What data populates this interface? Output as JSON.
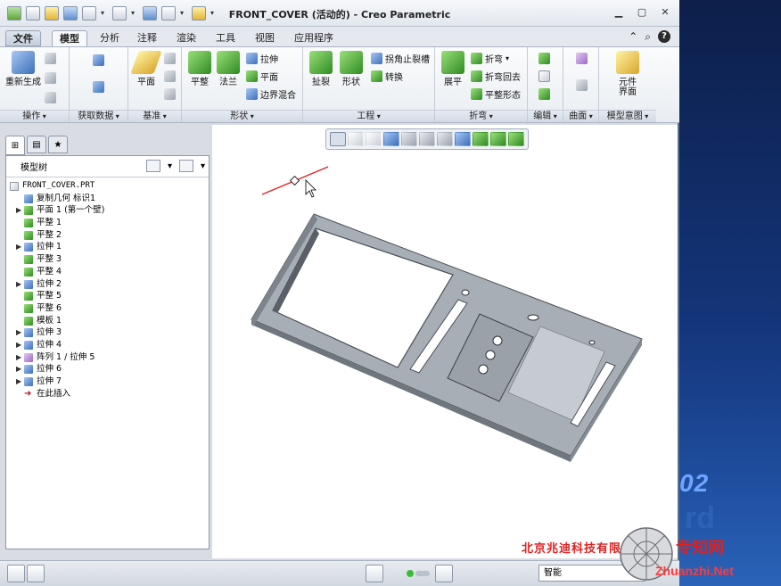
{
  "window": {
    "title": "FRONT_COVER (活动的) - Creo Parametric"
  },
  "tabs": [
    {
      "label": "文件"
    },
    {
      "label": "模型"
    },
    {
      "label": "分析"
    },
    {
      "label": "注释"
    },
    {
      "label": "渲染"
    },
    {
      "label": "工具"
    },
    {
      "label": "视图"
    },
    {
      "label": "应用程序"
    }
  ],
  "ribbon": {
    "groups": {
      "operations": "操作",
      "get_data": "获取数据",
      "datum": "基准",
      "shapes": "形状",
      "engineering": "工程",
      "bends": "折弯",
      "editing": "编辑",
      "surfaces": "曲面",
      "model_intent": "模型意图"
    },
    "buttons": {
      "regenerate": "重新生成",
      "plane": "平面",
      "flat": "平整",
      "flange": "法兰",
      "extrude": "拉伸",
      "planar": "平面",
      "boundary_blend": "边界混合",
      "rip": "扯裂",
      "form": "形状",
      "corner_relief": "拐角止裂槽",
      "convert": "转换",
      "unbend": "展平",
      "bend": "折弯",
      "bend_back": "折弯回去",
      "flat_state": "平整形态",
      "component_interface_1": "元件",
      "component_interface_2": "界面"
    }
  },
  "navigator": {
    "header": "模型树",
    "items": [
      {
        "label": "FRONT_COVER.PRT",
        "expand": ""
      },
      {
        "label": "复制几何 标识1",
        "expand": ""
      },
      {
        "label": "平面 1 (第一个壁)",
        "expand": "▶"
      },
      {
        "label": "平整 1",
        "expand": ""
      },
      {
        "label": "平整 2",
        "expand": ""
      },
      {
        "label": "拉伸 1",
        "expand": "▶"
      },
      {
        "label": "平整 3",
        "expand": ""
      },
      {
        "label": "平整 4",
        "expand": ""
      },
      {
        "label": "拉伸 2",
        "expand": "▶"
      },
      {
        "label": "平整 5",
        "expand": ""
      },
      {
        "label": "平整 6",
        "expand": ""
      },
      {
        "label": "模板 1",
        "expand": ""
      },
      {
        "label": "拉伸 3",
        "expand": "▶"
      },
      {
        "label": "拉伸 4",
        "expand": "▶"
      },
      {
        "label": "阵列 1 / 拉伸 5",
        "expand": "▶"
      },
      {
        "label": "拉伸 6",
        "expand": "▶"
      },
      {
        "label": "拉伸 7",
        "expand": "▶"
      },
      {
        "label": "在此插入",
        "expand": ""
      }
    ]
  },
  "statusbar": {
    "filter": "智能"
  },
  "desktop": {
    "number_fragment": "02"
  },
  "watermark": {
    "cn": "北京兆迪科技有限公司",
    "site_cn": "专知网",
    "url": "Zhuanzhi.Net"
  },
  "colors": {
    "accent": "#2f8a22",
    "sheet_metal": "#a7aeb6",
    "datum_plane": "#e02020"
  }
}
